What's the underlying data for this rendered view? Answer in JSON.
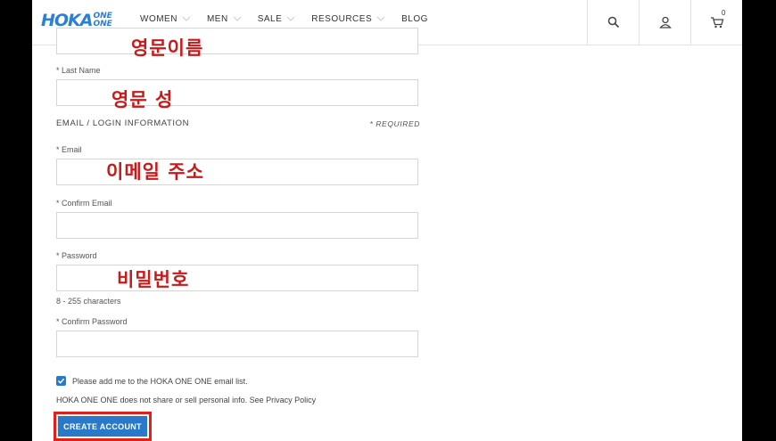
{
  "header": {
    "logo_main": "HOKA",
    "logo_sub_top": "ONE",
    "logo_sub_bottom": "ONE",
    "nav": [
      {
        "label": "WOMEN"
      },
      {
        "label": "MEN"
      },
      {
        "label": "SALE"
      },
      {
        "label": "RESOURCES"
      },
      {
        "label": "BLOG"
      }
    ],
    "icons": [
      "search-icon",
      "account-icon",
      "cart-icon"
    ],
    "cart_count": "0"
  },
  "form": {
    "last_name_label": "* Last Name",
    "section_title": "EMAIL / LOGIN INFORMATION",
    "required_note": "* REQUIRED",
    "email_label": "* Email",
    "confirm_email_label": "* Confirm Email",
    "password_label": "* Password",
    "password_hint": "8 - 255 characters",
    "confirm_password_label": "* Confirm Password",
    "newsletter_label": "Please add me to the HOKA ONE ONE email list.",
    "newsletter_checked": true,
    "privacy_note": "HOKA ONE ONE does not share or sell personal info. See Privacy Policy",
    "create_button": "CREATE ACCOUNT"
  },
  "annotations": {
    "first_name": "영문이름",
    "last_name": "영문 성",
    "email": "이메일 주소",
    "password": "비밀번호"
  },
  "colors": {
    "brand_blue": "#2a79c8",
    "annotation_red": "#c71a1a",
    "highlight_border": "#e0211b"
  }
}
